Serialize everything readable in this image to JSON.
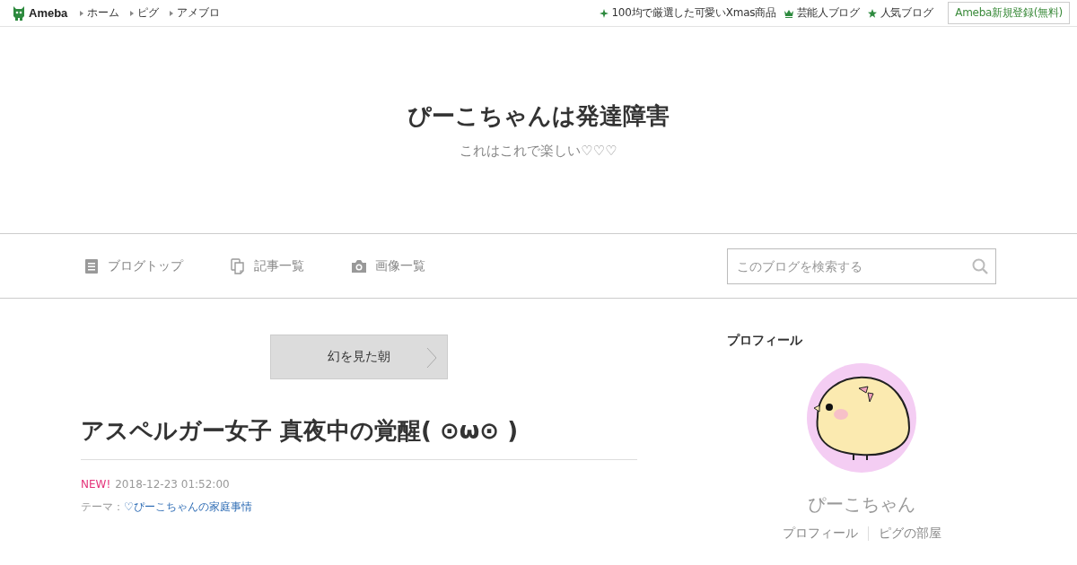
{
  "topbar": {
    "logo": "Ameba",
    "links": [
      "ホーム",
      "ピグ",
      "アメブロ"
    ],
    "promos": [
      {
        "kind": "sparkle",
        "label": "100均で厳選した可愛いXmas商品"
      },
      {
        "kind": "crown",
        "label": "芸能人ブログ"
      },
      {
        "kind": "star",
        "label": "人気ブログ"
      }
    ],
    "signup": "Ameba新規登録(無料)"
  },
  "blog": {
    "title": "ぴーこちゃんは発達障害",
    "subtitle": "これはこれで楽しい♡♡♡"
  },
  "nav": {
    "items": [
      {
        "kind": "list",
        "label": "ブログトップ"
      },
      {
        "kind": "pages",
        "label": "記事一覧"
      },
      {
        "kind": "camera",
        "label": "画像一覧"
      }
    ],
    "search": {
      "placeholder": "このブログを検索する"
    }
  },
  "article": {
    "prev_link": "幻を見た朝",
    "title": "アスペルガー女子 真夜中の覚醒( ⊙ω⊙ )",
    "new_badge": "NEW!",
    "date": "2018-12-23 01:52:00",
    "theme_label": "テーマ：",
    "theme": "♡ぴーこちゃんの家庭事情"
  },
  "sidebar": {
    "heading": "プロフィール",
    "avatar": {
      "kind": "picture"
    },
    "name": "ぴーこちゃん",
    "links": [
      "プロフィール",
      "ピグの部屋"
    ]
  }
}
